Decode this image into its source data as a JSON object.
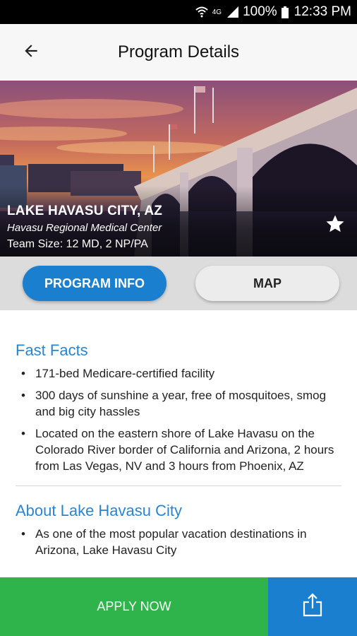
{
  "status_bar": {
    "network": "4G",
    "battery": "100%",
    "time": "12:33 PM",
    "icons": [
      "wifi-icon",
      "signal-icon",
      "battery-icon"
    ]
  },
  "app_bar": {
    "title": "Program Details",
    "back_icon": "arrow-left-icon"
  },
  "hero": {
    "city": "LAKE HAVASU CITY, AZ",
    "center": "Havasu Regional Medical Center",
    "team_size": "Team Size: 12 MD, 2 NP/PA",
    "favorite_icon": "star-icon"
  },
  "tabs": {
    "program_info": "PROGRAM INFO",
    "map": "MAP",
    "active": "program_info"
  },
  "fast_facts": {
    "heading": "Fast Facts",
    "items": [
      "171-bed Medicare-certified facility",
      "300 days of sunshine a year, free of mosquitoes, smog and big city hassles",
      "Located on the eastern shore of Lake Havasu on the Colorado River border of California and Arizona, 2 hours from Las Vegas, NV and 3 hours from Phoenix, AZ"
    ]
  },
  "about": {
    "heading": "About Lake Havasu City",
    "items": [
      "As one of the most popular vacation destinations in Arizona, Lake Havasu City"
    ]
  },
  "bottom_bar": {
    "apply_label": "APPLY NOW",
    "share_icon": "share-icon"
  },
  "colors": {
    "primary_blue": "#1b7fd0",
    "heading_blue": "#2a85cf",
    "apply_green": "#2fb44b",
    "tab_bar_gray": "#dcdcdc"
  }
}
